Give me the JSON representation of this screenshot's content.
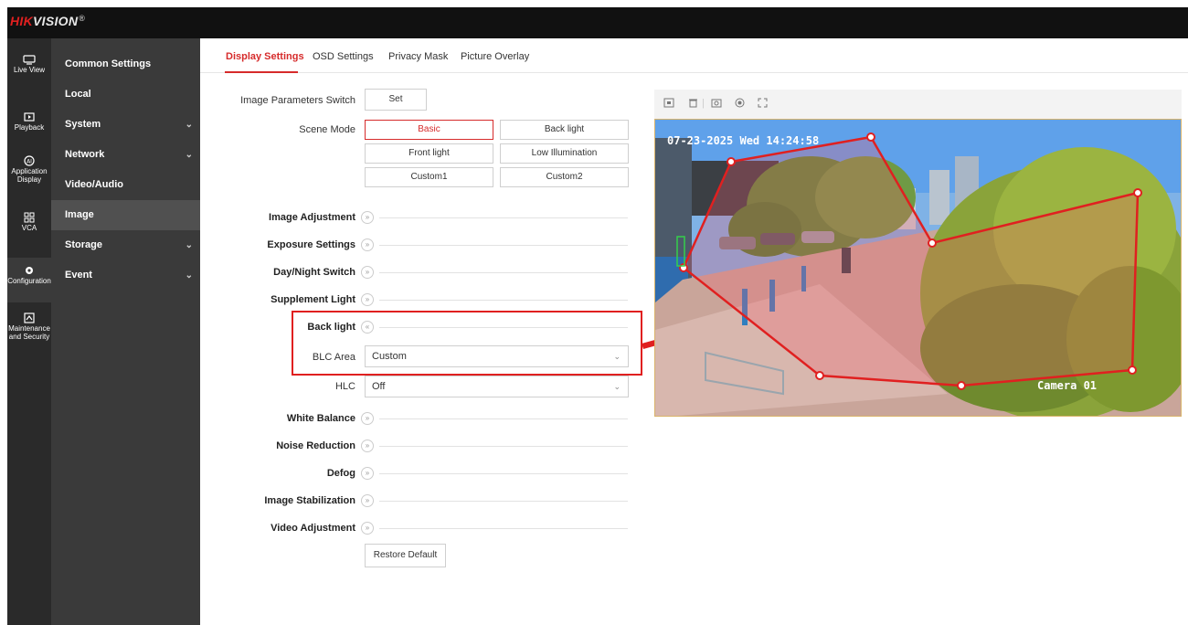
{
  "brand": {
    "name_part1": "HIK",
    "name_part2": "VISION",
    "reg": "®"
  },
  "nav": {
    "live_view": "Live View",
    "playback": "Playback",
    "app_display_1": "Application",
    "app_display_2": "Display",
    "vca": "VCA",
    "configuration": "Configuration",
    "maintenance_1": "Maintenance",
    "maintenance_2": "and Security"
  },
  "menu": {
    "common_settings": "Common Settings",
    "local": "Local",
    "system": "System",
    "network": "Network",
    "video_audio": "Video/Audio",
    "image": "Image",
    "storage": "Storage",
    "event": "Event",
    "chevron": "⌄"
  },
  "tabs": {
    "display_settings": "Display Settings",
    "osd_settings": "OSD Settings",
    "privacy_mask": "Privacy Mask",
    "picture_overlay": "Picture Overlay"
  },
  "form": {
    "image_params_switch_label": "Image Parameters Switch",
    "set_button": "Set",
    "scene_mode_label": "Scene Mode",
    "scene_modes": {
      "basic": "Basic",
      "back_light": "Back light",
      "front_light": "Front light",
      "low_illumination": "Low Illumination",
      "custom1": "Custom1",
      "custom2": "Custom2"
    },
    "selected_scene": "Basic",
    "sections": {
      "image_adjustment": "Image Adjustment",
      "exposure_settings": "Exposure Settings",
      "day_night_switch": "Day/Night Switch",
      "supplement_light": "Supplement Light",
      "back_light": "Back light",
      "white_balance": "White Balance",
      "noise_reduction": "Noise Reduction",
      "defog": "Defog",
      "image_stabilization": "Image Stabilization",
      "video_adjustment": "Video Adjustment"
    },
    "blc_area_label": "BLC Area",
    "blc_area_value": "Custom",
    "hlc_label": "HLC",
    "hlc_value": "Off",
    "restore_default": "Restore Default",
    "collapsed_glyph": "»",
    "expanded_glyph": "«",
    "caret": "⌄"
  },
  "preview": {
    "tool_icons": [
      "picture-in-picture-icon",
      "delete-icon",
      "capture-icon",
      "record-icon",
      "fullscreen-icon"
    ],
    "timestamp": "07-23-2025 Wed 14:24:58",
    "camera_name": "Camera 01"
  },
  "colors": {
    "accent": "#d62b2b",
    "topbar": "#111111",
    "nav": "#2a2a2a",
    "menu": "#3a3a3a",
    "menu_active": "#505050"
  }
}
